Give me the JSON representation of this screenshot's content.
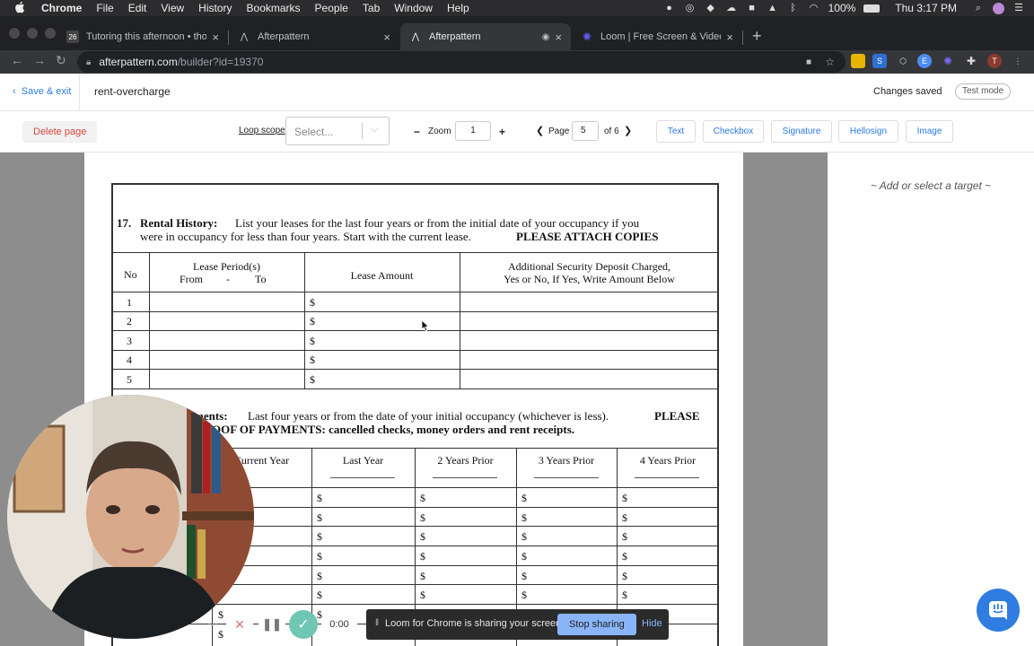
{
  "menubar": {
    "app": "Chrome",
    "items": [
      "File",
      "Edit",
      "View",
      "History",
      "Bookmarks",
      "People",
      "Tab",
      "Window",
      "Help"
    ],
    "battery": "100%",
    "clock": "Thu 3:17 PM"
  },
  "tabs": [
    {
      "title": "Tutoring this afternoon • thomas",
      "badge": "26"
    },
    {
      "title": "Afterpattern"
    },
    {
      "title": "Afterpattern"
    },
    {
      "title": "Loom | Free Screen & Video Recording"
    }
  ],
  "address": {
    "host": "afterpattern.com",
    "path": "/builder?id=19370"
  },
  "header": {
    "back_label": "Save & exit",
    "doc_name": "rent-overcharge",
    "status": "Changes saved",
    "test_mode": "Test mode"
  },
  "toolbar": {
    "delete_page": "Delete page",
    "loop_scope": "Loop scope",
    "select_placeholder": "Select...",
    "zoom_label": "Zoom",
    "zoom_value": "1",
    "page_label": "Page",
    "page_value": "5",
    "page_of": "of 6",
    "tools": [
      "Text",
      "Checkbox",
      "Signature",
      "Hellosign",
      "Image"
    ]
  },
  "right_panel": {
    "hint": "~ Add or select a target ~"
  },
  "form": {
    "section17": {
      "number": "17.",
      "title": "Rental History:",
      "text1": "List your leases for the last four years or from the initial date of your occupancy if you",
      "text2a": "were in occupancy for less than four years.  Start with the current lease.",
      "text2b": "PLEASE ATTACH COPIES",
      "col_no": "No",
      "col_period": "Lease Period(s)",
      "col_from": "From",
      "col_dash": "-",
      "col_to": "To",
      "col_amount": "Lease Amount",
      "col_deposit1": "Additional Security Deposit Charged,",
      "col_deposit2": "Yes or No,  If Yes, Write Amount Below",
      "rows": [
        "1",
        "2",
        "3",
        "4",
        "5"
      ],
      "currency": "$"
    },
    "section18": {
      "title_tail": "ments:",
      "text1": "Last four years or from the date of your initial occupancy (whichever is less).",
      "text1b": "PLEASE",
      "text2": "OOF OF PAYMENTS: cancelled checks, money orders and rent receipts.",
      "columns": [
        "Current Year",
        "Last Year",
        "2 Years Prior",
        "3 Years Prior",
        "4 Years Prior"
      ],
      "currency": "$"
    }
  },
  "loom": {
    "timer": "0:00",
    "share_msg": "Loom for Chrome is sharing your screen.",
    "stop": "Stop sharing",
    "hide": "Hide"
  }
}
